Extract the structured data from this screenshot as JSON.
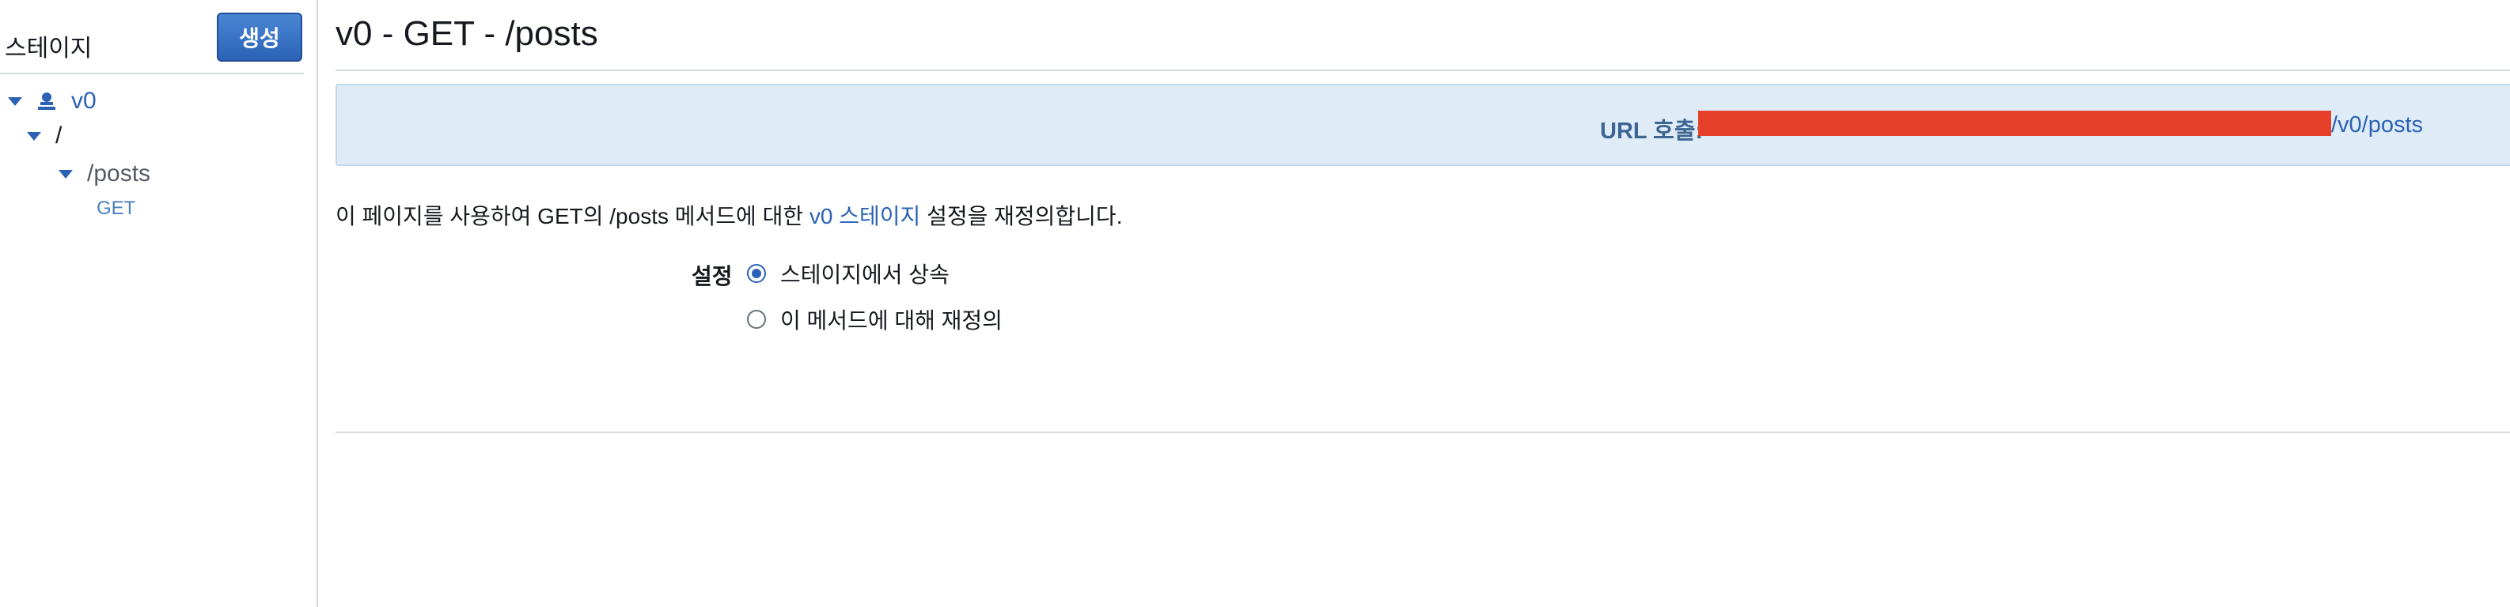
{
  "sidebar": {
    "title": "스테이지",
    "create_button": "생성",
    "tree": {
      "stage": "v0",
      "root": "/",
      "resource": "/posts",
      "method": "GET"
    }
  },
  "main": {
    "title": "v0 - GET - /posts",
    "invoke_url_label": "URL 호출:",
    "invoke_url_suffix": "/v0/posts",
    "description_prefix": "이 페이지를 사용하여 GET의 /posts 메서드에 대한 ",
    "description_link": "v0 스테이지",
    "description_suffix": " 설정을 재정의합니다.",
    "settings_label": "설정",
    "options": [
      {
        "label": "스테이지에서 상속",
        "selected": true
      },
      {
        "label": "이 메서드에 대해 재정의",
        "selected": false
      }
    ]
  },
  "colors": {
    "accent": "#2b62b5",
    "redaction": "#e6402b",
    "url_box_bg": "#dfecf7"
  }
}
